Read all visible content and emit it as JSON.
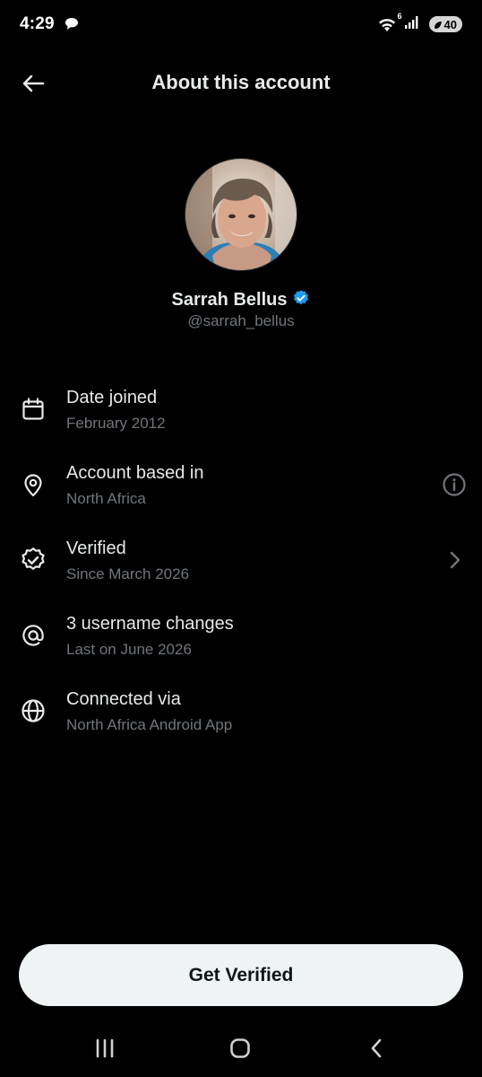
{
  "status_bar": {
    "time": "4:29",
    "wifi_badge": "6",
    "battery_level": "40"
  },
  "header": {
    "title": "About this account"
  },
  "profile": {
    "name": "Sarrah Bellus",
    "handle": "@sarrah_bellus",
    "verified": true,
    "verified_color": "#1d9bf0"
  },
  "info_rows": [
    {
      "icon": "calendar-icon",
      "title": "Date joined",
      "subtitle": "February 2012"
    },
    {
      "icon": "location-pin-icon",
      "title": "Account based in",
      "subtitle": "North Africa",
      "trailing": "info-icon"
    },
    {
      "icon": "verified-badge-icon",
      "title": "Verified",
      "subtitle": "Since March 2026",
      "trailing": "chevron-right-icon"
    },
    {
      "icon": "at-sign-icon",
      "title": "3 username changes",
      "subtitle": "Last on June 2026"
    },
    {
      "icon": "globe-icon",
      "title": "Connected via",
      "subtitle": "North Africa Android App"
    }
  ],
  "cta": {
    "label": "Get Verified"
  },
  "colors": {
    "background": "#000000",
    "primary_text": "#e7e9ea",
    "secondary_text": "#71767b",
    "button_bg": "#eff3f4",
    "button_text": "#0f1419"
  }
}
